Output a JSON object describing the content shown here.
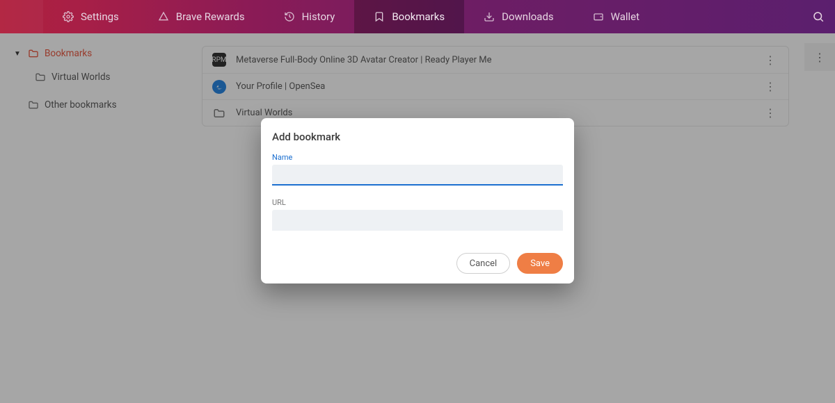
{
  "topnav": {
    "tabs": [
      {
        "id": "settings",
        "label": "Settings",
        "active": false
      },
      {
        "id": "rewards",
        "label": "Brave Rewards",
        "active": false
      },
      {
        "id": "history",
        "label": "History",
        "active": false
      },
      {
        "id": "bookmarks",
        "label": "Bookmarks",
        "active": true
      },
      {
        "id": "downloads",
        "label": "Downloads",
        "active": false
      },
      {
        "id": "wallet",
        "label": "Wallet",
        "active": false
      }
    ]
  },
  "sidebar": {
    "root_label": "Bookmarks",
    "children": [
      {
        "label": "Virtual Worlds"
      }
    ],
    "other_label": "Other bookmarks"
  },
  "list": {
    "items": [
      {
        "kind": "rpm",
        "title": "Metaverse Full-Body Online 3D Avatar Creator | Ready Player Me"
      },
      {
        "kind": "osea",
        "title": "Your Profile | OpenSea"
      },
      {
        "kind": "folder",
        "title": "Virtual Worlds"
      }
    ]
  },
  "dialog": {
    "title": "Add bookmark",
    "name_label": "Name",
    "name_value": "",
    "url_label": "URL",
    "url_value": "",
    "cancel": "Cancel",
    "save": "Save"
  }
}
